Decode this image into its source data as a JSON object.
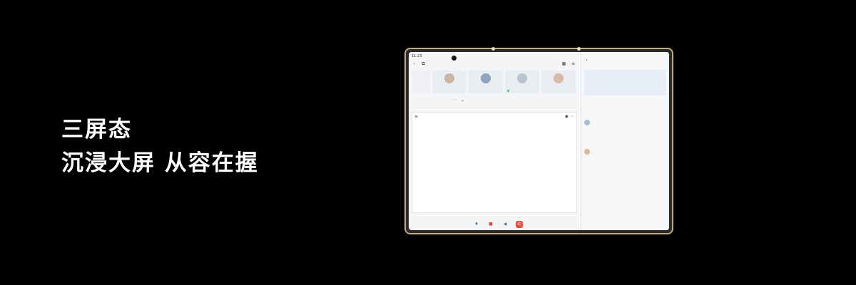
{
  "slide": {
    "headline_1": "三屏态",
    "headline_2": "沉浸大屏 从容在握",
    "footer_tag": ""
  },
  "device": {
    "status_time": "11:23",
    "meeting_title": "",
    "participants": [
      {
        "name": "",
        "mic": false
      },
      {
        "name": "",
        "mic": false
      },
      {
        "name": "",
        "mic": true
      },
      {
        "name": "",
        "mic": false
      }
    ],
    "share_status": "",
    "doc": {
      "title": "",
      "outline": [],
      "sections": []
    },
    "controls": [
      "mic-icon",
      "camera-icon",
      "speaker-icon",
      "hang-up-icon"
    ],
    "chat": {
      "title": "",
      "notice": "",
      "section_label": "",
      "messages": [
        {
          "name": "",
          "text": ""
        },
        {
          "name": "",
          "text": ""
        }
      ],
      "input_placeholder": ""
    }
  }
}
